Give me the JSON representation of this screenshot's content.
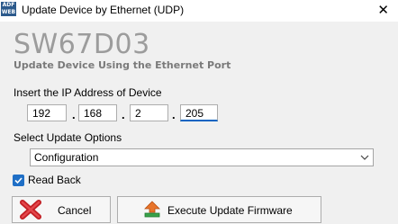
{
  "window": {
    "title": "Update Device by Ethernet (UDP)",
    "icon_text": "ADF WEB",
    "close_glyph": "✕"
  },
  "product": {
    "name": "SW67D03",
    "subtitle": "Update Device Using the Ethernet Port"
  },
  "ip": {
    "label": "Insert the IP Address of Device",
    "octets": [
      "192",
      "168",
      "2",
      "205"
    ],
    "separator": "."
  },
  "options": {
    "label": "Select Update Options",
    "selected": "Configuration"
  },
  "read_back": {
    "label": "Read Back",
    "checked": true
  },
  "buttons": {
    "cancel": "Cancel",
    "execute": "Execute Update Firmware"
  },
  "icons": {
    "app": "adfweb-logo-icon",
    "close": "close-icon",
    "dropdown": "chevron-down-icon",
    "checkbox": "checkmark-icon",
    "cancel": "red-x-icon",
    "execute": "upload-firmware-icon"
  },
  "colors": {
    "accent": "#1f6fc6",
    "title_gray": "#9c9c9c",
    "cancel_red": "#d4262b"
  }
}
